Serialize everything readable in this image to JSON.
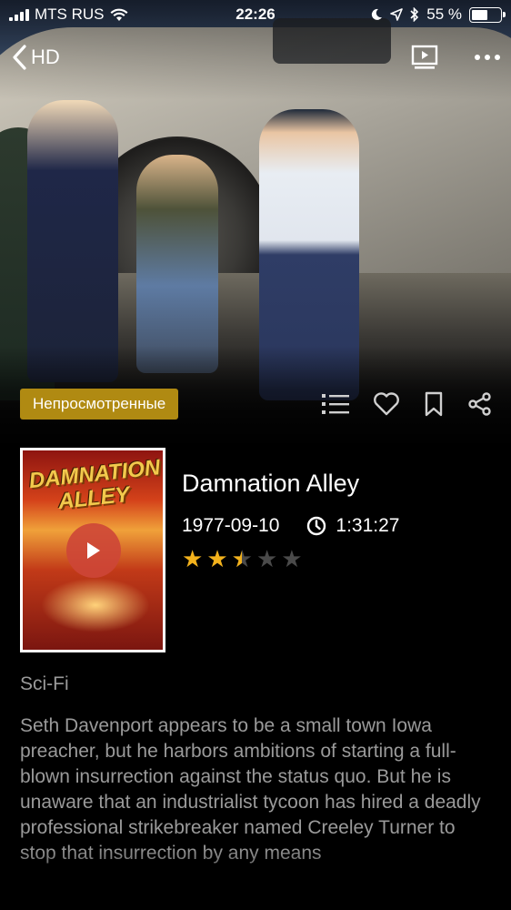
{
  "status_bar": {
    "carrier": "MTS RUS",
    "time": "22:26",
    "battery_percent": "55 %",
    "battery_level": 0.55
  },
  "nav": {
    "back_label": "HD",
    "back_icon": "chevron-left-icon",
    "trailer_icon": "screen-play-icon",
    "more_icon": "more-dots-icon"
  },
  "badge": {
    "label": "Непросмотренные",
    "color": "#b08a12"
  },
  "actions": [
    "list-icon",
    "heart-icon",
    "bookmark-icon",
    "share-icon"
  ],
  "movie": {
    "title": "Damnation Alley",
    "date": "1977-09-10",
    "duration": "1:31:27",
    "rating_stars": 2.5,
    "rating_max": 5,
    "genre": "Sci-Fi",
    "description": "Seth Davenport appears to be a small town Iowa preacher, but he harbors ambitions of starting a full-blown insurrection against the status quo. But he is unaware that an industrialist tycoon has hired a deadly professional strikebreaker named Creeley Turner to stop that insurrection by any means"
  },
  "poster": {
    "title_art": "DAMNATION ALLEY"
  },
  "colors": {
    "star_filled": "#f3b21c",
    "star_empty": "#4a4a4a",
    "play_button": "#cd4637",
    "secondary_text": "#9a9a9a"
  }
}
